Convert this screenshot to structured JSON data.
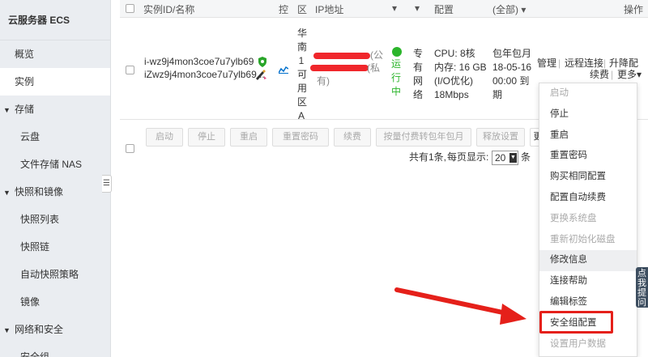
{
  "sidebar": {
    "title": "云服务器 ECS",
    "items": [
      {
        "label": "概览",
        "kind": "item"
      },
      {
        "label": "实例",
        "kind": "item",
        "active": true
      },
      {
        "label": "存储",
        "kind": "group"
      },
      {
        "label": "云盘",
        "kind": "sub"
      },
      {
        "label": "文件存储 NAS",
        "kind": "sub"
      },
      {
        "label": "快照和镜像",
        "kind": "group"
      },
      {
        "label": "快照列表",
        "kind": "sub"
      },
      {
        "label": "快照链",
        "kind": "sub"
      },
      {
        "label": "自动快照策略",
        "kind": "sub"
      },
      {
        "label": "镜像",
        "kind": "sub"
      },
      {
        "label": "网络和安全",
        "kind": "group"
      },
      {
        "label": "安全组",
        "kind": "sub"
      }
    ],
    "collapse_glyph": "☰"
  },
  "table": {
    "headers": {
      "id_name": "实例ID/名称",
      "monitor": "控",
      "zone": "区",
      "ip": "IP地址",
      "status_caret": "▾",
      "network_caret": "▾",
      "config": "配置",
      "billing": "(全部) ▾",
      "ops": "操作"
    },
    "row": {
      "instance_id": "i-wz9j4mon3coe7u7ylb69",
      "instance_name": "iZwz9j4mon3coe7u7ylb69...",
      "zone_lines": [
        "华",
        "南",
        "1",
        "可",
        "用",
        "区",
        "A"
      ],
      "ip_public_suffix": "(公",
      "ip_private_suffix": "(私",
      "ip_private_tail": "有)",
      "status_lines": [
        "运",
        "行",
        "中"
      ],
      "status_color": "#2bb52b",
      "network_lines": [
        "专",
        "有",
        "网",
        "络"
      ],
      "config_lines": [
        "CPU:  8核",
        "内存: 16 GB",
        "(I/O优化)",
        "18Mbps"
      ],
      "billing_lines": [
        "包年包月",
        "18-05-16",
        "00:00 到",
        "期"
      ],
      "op_manage": "管理",
      "op_remote": "远程连接",
      "op_upgrade": "升降配",
      "op_renew": "续费",
      "op_more": "更多▾"
    }
  },
  "batch_buttons": [
    "启动",
    "停止",
    "重启",
    "重置密码",
    "续费",
    "按量付费转包年包月",
    "释放设置",
    "更"
  ],
  "pager": {
    "total": "共有1条,",
    "per_page_label": "每页显示:",
    "per_page_value": "20",
    "suffix": "条"
  },
  "more_menu": [
    {
      "label": "启动",
      "disabled": true
    },
    {
      "label": "停止"
    },
    {
      "label": "重启"
    },
    {
      "label": "重置密码"
    },
    {
      "label": "购买相同配置"
    },
    {
      "label": "配置自动续费"
    },
    {
      "label": "更换系统盘",
      "disabled": true
    },
    {
      "label": "重新初始化磁盘",
      "disabled": true
    },
    {
      "label": "修改信息",
      "hover": true
    },
    {
      "label": "连接帮助"
    },
    {
      "label": "编辑标签"
    },
    {
      "label": "安全组配置",
      "highlighted": true
    },
    {
      "label": "设置用户数据",
      "disabled": true
    }
  ],
  "float_tab": [
    "点",
    "我",
    "提",
    "问"
  ],
  "annotation": {
    "color": "#e5201a"
  }
}
